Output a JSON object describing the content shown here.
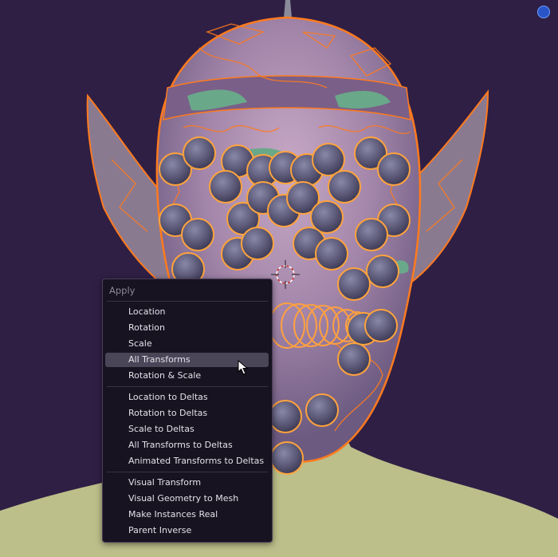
{
  "menu": {
    "title": "Apply",
    "items": [
      {
        "label": "Location"
      },
      {
        "label": "Rotation"
      },
      {
        "label": "Scale"
      },
      {
        "label": "All Transforms",
        "active": true
      },
      {
        "label": "Rotation & Scale"
      },
      {
        "label": "Location to Deltas"
      },
      {
        "label": "Rotation to Deltas"
      },
      {
        "label": "Scale to Deltas"
      },
      {
        "label": "All Transforms to Deltas"
      },
      {
        "label": "Animated Transforms to Deltas"
      },
      {
        "label": "Visual Transform"
      },
      {
        "label": "Visual Geometry to Mesh"
      },
      {
        "label": "Make Instances Real"
      },
      {
        "label": "Parent Inverse"
      }
    ]
  },
  "viewport": {
    "background_color": "#2f1f45",
    "selection_outline_color": "#ff7a1e",
    "head_color": "#9d7fa8",
    "neck_color": "#bcbf8a",
    "icons": [
      "navigation-gizmo-icon",
      "3d-cursor-icon",
      "mouse-pointer-icon"
    ]
  }
}
